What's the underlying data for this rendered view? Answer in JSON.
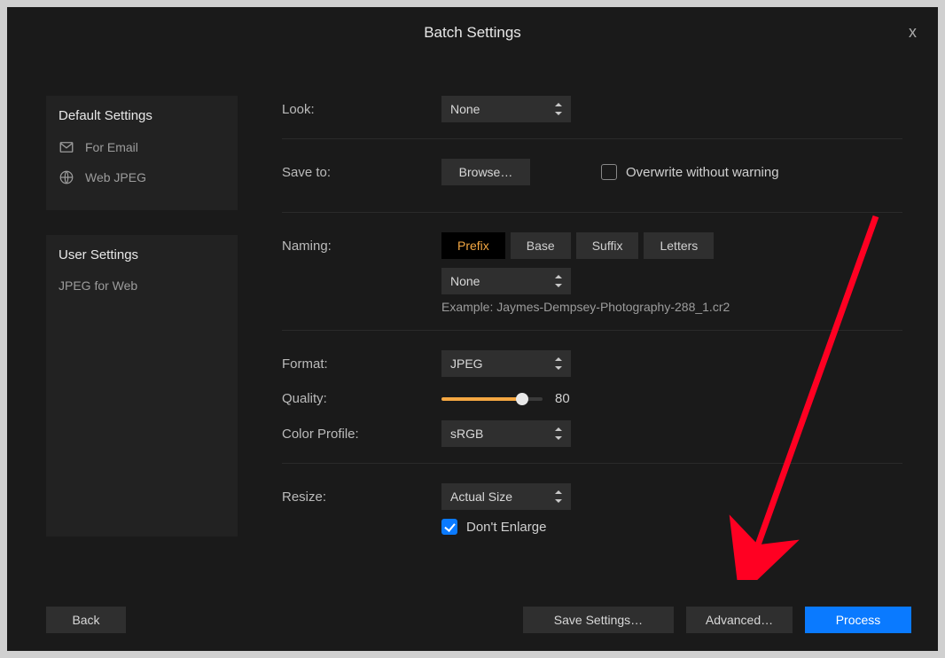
{
  "title": "Batch Settings",
  "close_glyph": "x",
  "sidebar": {
    "default_header": "Default Settings",
    "default_items": [
      {
        "icon": "mail-icon",
        "label": "For Email"
      },
      {
        "icon": "globe-icon",
        "label": "Web JPEG"
      }
    ],
    "user_header": "User Settings",
    "user_items": [
      {
        "icon": null,
        "label": "JPEG for Web"
      }
    ]
  },
  "fields": {
    "look_label": "Look:",
    "look_value": "None",
    "save_to_label": "Save to:",
    "browse_label": "Browse…",
    "overwrite_label": "Overwrite without warning",
    "overwrite_checked": false,
    "naming_label": "Naming:",
    "naming_tabs": [
      "Prefix",
      "Base",
      "Suffix",
      "Letters"
    ],
    "naming_active_tab": 0,
    "naming_value": "None",
    "naming_example": "Example: Jaymes-Dempsey-Photography-288_1.cr2",
    "format_label": "Format:",
    "format_value": "JPEG",
    "quality_label": "Quality:",
    "quality_value": "80",
    "colorprofile_label": "Color Profile:",
    "colorprofile_value": "sRGB",
    "resize_label": "Resize:",
    "resize_value": "Actual Size",
    "dont_enlarge_label": "Don't Enlarge",
    "dont_enlarge_checked": true
  },
  "footer": {
    "back": "Back",
    "save_settings": "Save Settings…",
    "advanced": "Advanced…",
    "process": "Process"
  },
  "annotation": {
    "arrow_color": "#ff0022"
  }
}
